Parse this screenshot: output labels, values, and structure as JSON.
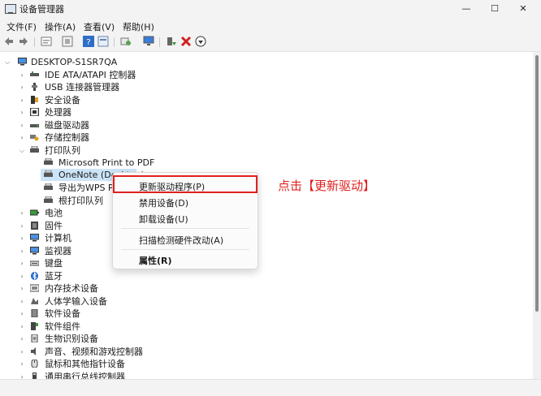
{
  "window": {
    "title": "设备管理器",
    "minimize_glyph": "—",
    "maximize_glyph": "☐",
    "close_glyph": "✕"
  },
  "menu": [
    "文件(F)",
    "操作(A)",
    "查看(V)",
    "帮助(H)"
  ],
  "toolbar": {
    "icons": [
      "back-arrow-icon",
      "forward-arrow-icon",
      "properties-icon",
      "update-icon",
      "help-icon",
      "view-icon",
      "scan-icon",
      "monitor-icon",
      "enable-icon",
      "delete-icon",
      "download-icon"
    ]
  },
  "tree": {
    "root": "DESKTOP-S1SR7QA",
    "items": [
      {
        "label": "IDE ATA/ATAPI 控制器",
        "icon": "ide-controller-icon",
        "expanded": false
      },
      {
        "label": "USB 连接器管理器",
        "icon": "usb-icon",
        "expanded": false
      },
      {
        "label": "安全设备",
        "icon": "security-device-icon",
        "expanded": false
      },
      {
        "label": "处理器",
        "icon": "processor-icon",
        "expanded": false
      },
      {
        "label": "磁盘驱动器",
        "icon": "disk-drive-icon",
        "expanded": false
      },
      {
        "label": "存储控制器",
        "icon": "storage-controller-icon",
        "expanded": false
      },
      {
        "label": "打印队列",
        "icon": "printer-icon",
        "expanded": true
      }
    ],
    "print_queue_children": [
      "Microsoft Print to PDF",
      "OneNote (Desktop)",
      "导出为WPS PDF",
      "根打印队列"
    ],
    "items_after": [
      {
        "label": "电池",
        "icon": "battery-icon"
      },
      {
        "label": "固件",
        "icon": "firmware-icon"
      },
      {
        "label": "计算机",
        "icon": "computer-icon"
      },
      {
        "label": "监视器",
        "icon": "monitor-icon"
      },
      {
        "label": "键盘",
        "icon": "keyboard-icon"
      },
      {
        "label": "蓝牙",
        "icon": "bluetooth-icon"
      },
      {
        "label": "内存技术设备",
        "icon": "memory-device-icon"
      },
      {
        "label": "人体学输入设备",
        "icon": "hid-icon"
      },
      {
        "label": "软件设备",
        "icon": "software-device-icon"
      },
      {
        "label": "软件组件",
        "icon": "software-component-icon"
      },
      {
        "label": "生物识别设备",
        "icon": "biometric-icon"
      },
      {
        "label": "声音、视频和游戏控制器",
        "icon": "sound-icon"
      },
      {
        "label": "鼠标和其他指针设备",
        "icon": "mouse-icon"
      },
      {
        "label": "通用串行总线控制器",
        "icon": "usb-controller-icon"
      }
    ]
  },
  "context_menu": {
    "update_driver": "更新驱动程序(P)",
    "disable_device": "禁用设备(D)",
    "uninstall_device": "卸载设备(U)",
    "scan_hardware": "扫描检测硬件改动(A)",
    "properties": "属性(R)"
  },
  "annotation": "点击【更新驱动】",
  "colors": {
    "highlight": "#e02020",
    "selection": "#cce4f7"
  }
}
